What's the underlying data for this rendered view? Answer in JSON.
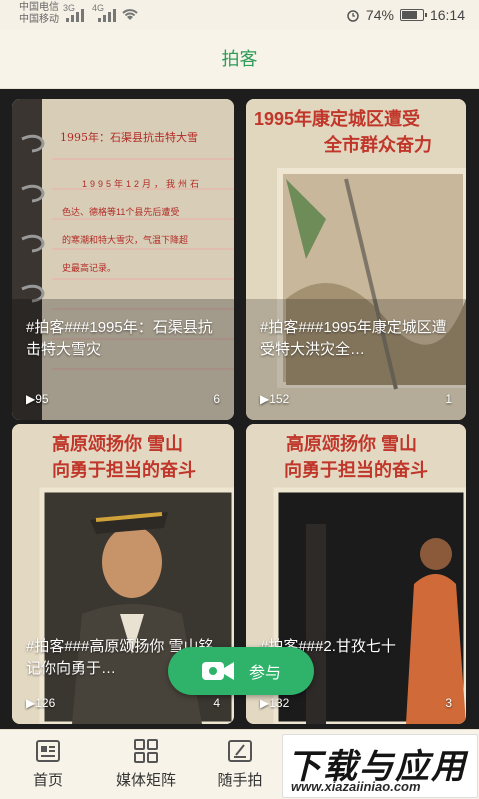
{
  "statusbar": {
    "carrier1": "中国电信",
    "carrier2": "中国移动",
    "sig1": "3G",
    "sig2": "4G",
    "battery": "74%",
    "time": "16:14",
    "battery_level": 0.74
  },
  "header": {
    "title": "拍客"
  },
  "cards": [
    {
      "caption": "#拍客###1995年：石渠县抗击特大雪灾",
      "plays": "95",
      "count": "6",
      "doc_title": "1995年：石渠县抗击特大雪",
      "doc_line1": "1995年12月，我州石",
      "doc_line2": "色达、德格等11个县先后遭受",
      "doc_line3": "的寒潮和特大雪灾，气温下降超",
      "doc_line4": "史最高记录。"
    },
    {
      "caption": "#拍客###1995年康定城区遭受特大洪灾全…",
      "plays": "152",
      "count": "1",
      "banner1": "1995年康定城区遭受",
      "banner2": "全市群众奋力"
    },
    {
      "caption": "#拍客###高原颂扬你 雪山铭记你向勇于…",
      "plays": "126",
      "count": "4",
      "banner1": "高原颂扬你 雪山",
      "banner2": "向勇于担当的奋斗"
    },
    {
      "caption": "#拍客###2.甘孜七十",
      "plays": "132",
      "count": "3",
      "banner1": "高原颂扬你 雪山",
      "banner2": "向勇于担当的奋斗"
    }
  ],
  "fab": {
    "label": "参与",
    "icon": "video-camera-icon"
  },
  "tabs": [
    {
      "label": "首页",
      "icon": "home-news-icon"
    },
    {
      "label": "媒体矩阵",
      "icon": "grid-icon"
    },
    {
      "label": "随手拍",
      "icon": "edit-icon"
    }
  ],
  "watermark": {
    "text": "下载与应用",
    "url": "www.xiazaiiniao.com"
  },
  "colors": {
    "accent": "#2fb36a",
    "header_bg": "#f7f3e9",
    "title": "#2e9c58"
  }
}
